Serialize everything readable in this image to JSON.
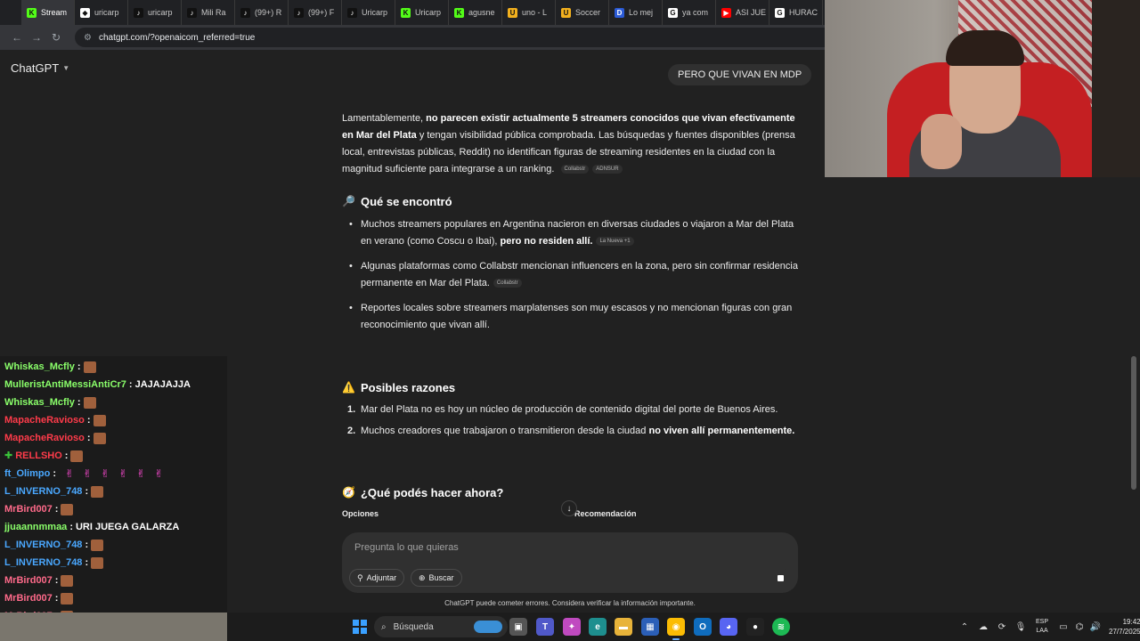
{
  "browser": {
    "tabs": [
      {
        "label": "Stream",
        "color": "#53fc18",
        "glyph": "K"
      },
      {
        "label": "uricarp",
        "color": "#ffffff",
        "glyph": "◆"
      },
      {
        "label": "uricarp",
        "color": "#111111",
        "glyph": "♪"
      },
      {
        "label": "Mili Ra",
        "color": "#111111",
        "glyph": "♪"
      },
      {
        "label": "(99+) R",
        "color": "#111111",
        "glyph": "♪"
      },
      {
        "label": "(99+) F",
        "color": "#111111",
        "glyph": "♪"
      },
      {
        "label": "Uricarp",
        "color": "#111111",
        "glyph": "♪"
      },
      {
        "label": "Uricarp",
        "color": "#53fc18",
        "glyph": "K"
      },
      {
        "label": "agusne",
        "color": "#53fc18",
        "glyph": "K"
      },
      {
        "label": "uno - L",
        "color": "#f2b01e",
        "glyph": "U"
      },
      {
        "label": "Soccer",
        "color": "#f2b01e",
        "glyph": "U"
      },
      {
        "label": "Lo mej",
        "color": "#2b5bd7",
        "glyph": "D"
      },
      {
        "label": "ya com",
        "color": "#ffffff",
        "glyph": "G"
      },
      {
        "label": "ASI JUE",
        "color": "#ff0000",
        "glyph": "▶"
      },
      {
        "label": "HURAC",
        "color": "#ffffff",
        "glyph": "G"
      },
      {
        "label": "",
        "color": "#3ac43a",
        "glyph": "✚"
      }
    ],
    "url": "chatgpt.com/?openaicom_referred=true"
  },
  "chatgpt": {
    "brand": "ChatGPT",
    "user_message": "PERO QUE VIVAN EN MDP",
    "intro": {
      "pre": "Lamentablemente, ",
      "bold": "no parecen existir actualmente 5 streamers conocidos que vivan efectivamente en Mar del Plata",
      "post": " y tengan visibilidad pública comprobada. Las búsquedas y fuentes disponibles (prensa local, entrevistas públicas, Reddit) no identifican figuras de streaming residentes en la ciudad con la magnitud suficiente para integrarse a un ranking.",
      "cite1": "Collabstr",
      "cite2": "ADNSUR"
    },
    "section1": {
      "emoji": "🔎",
      "title": "Qué se encontró",
      "b1_pre": "Muchos streamers populares en Argentina nacieron en diversas ciudades o viajaron a Mar del Plata en verano (como Coscu o Ibai), ",
      "b1_bold": "pero no residen allí.",
      "b1_cite": "La Nueva +1",
      "b2": "Algunas plataformas como Collabstr mencionan influencers en la zona, pero sin confirmar residencia permanente en Mar del Plata.",
      "b2_cite": "Collabstr",
      "b3": "Reportes locales sobre streamers marplatenses son muy escasos y no mencionan figuras con gran reconocimiento que vivan allí."
    },
    "section2": {
      "emoji": "⚠️",
      "title": "Posibles razones",
      "i1": "Mar del Plata no es hoy un núcleo de producción de contenido digital del porte de Buenos Aires.",
      "i2_pre": "Muchos creadores que trabajaron o transmitieron desde la ciudad ",
      "i2_bold": "no viven allí permanentemente."
    },
    "section3": {
      "emoji": "🧭",
      "title": "¿Qué podés hacer ahora?",
      "col1": "Opciones",
      "col2": "Recomendación"
    },
    "composer": {
      "placeholder": "Pregunta lo que quieras",
      "attach": "Adjuntar",
      "search": "Buscar"
    },
    "disclaimer": "ChatGPT puede cometer errores. Considera verificar la información importante."
  },
  "stream_chat": [
    {
      "user": "Whiskas_Mcfly",
      "color": "#8aff6a",
      "msg": "",
      "emote": "face"
    },
    {
      "user": "MulleristAntiMessiAntiCr7",
      "color": "#8aff6a",
      "msg": "JAJAJAJJA",
      "emote": ""
    },
    {
      "user": "Whiskas_Mcfly",
      "color": "#8aff6a",
      "msg": "",
      "emote": "face"
    },
    {
      "user": "MapacheRavioso",
      "color": "#ff3b4a",
      "msg": "",
      "emote": "face"
    },
    {
      "user": "MapacheRavioso",
      "color": "#ff3b4a",
      "msg": "",
      "emote": "face"
    },
    {
      "user": "RELLSHO",
      "color": "#ff3b4a",
      "msg": "",
      "emote": "face",
      "badge": true
    },
    {
      "user": "ft_Olimpo",
      "color": "#4aa8ff",
      "msg": "",
      "emote": "pink"
    },
    {
      "user": "L_INVERNO_748",
      "color": "#4aa8ff",
      "msg": "",
      "emote": "face"
    },
    {
      "user": "MrBird007",
      "color": "#ff6a8a",
      "msg": "",
      "emote": "face"
    },
    {
      "user": "jjuaannmmaa",
      "color": "#8aff6a",
      "msg": "URI JUEGA GALARZA",
      "emote": ""
    },
    {
      "user": "L_INVERNO_748",
      "color": "#4aa8ff",
      "msg": "",
      "emote": "face"
    },
    {
      "user": "L_INVERNO_748",
      "color": "#4aa8ff",
      "msg": "",
      "emote": "face"
    },
    {
      "user": "MrBird007",
      "color": "#ff6a8a",
      "msg": "",
      "emote": "face"
    },
    {
      "user": "MrBird007",
      "color": "#ff6a8a",
      "msg": "",
      "emote": "face"
    },
    {
      "user": "MrBird007",
      "color": "#ff6a8a",
      "msg": "",
      "emote": "face"
    },
    {
      "user": "MrBird007",
      "color": "#ff6a8a",
      "msg": "",
      "emote": "face"
    }
  ],
  "taskbar": {
    "search_placeholder": "Búsqueda",
    "lang_top": "ESP",
    "lang_bottom": "LAA",
    "time": "19:42",
    "date": "27/7/2025"
  }
}
